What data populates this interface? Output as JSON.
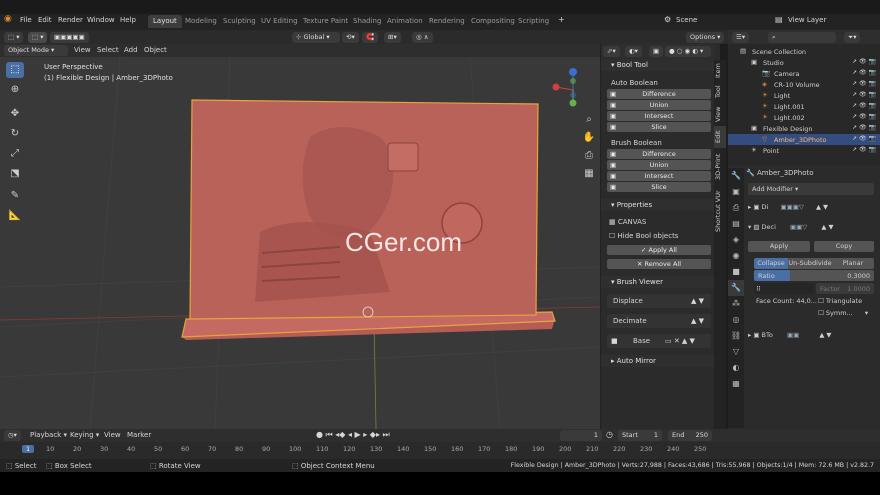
{
  "menu": {
    "file": "File",
    "edit": "Edit",
    "render": "Render",
    "window": "Window",
    "help": "Help"
  },
  "workspaces": [
    "Layout",
    "Modeling",
    "Sculpting",
    "UV Editing",
    "Texture Paint",
    "Shading",
    "Animation",
    "Rendering",
    "Compositing",
    "Scripting"
  ],
  "scene": {
    "label": "Scene",
    "view_layer": "View Layer"
  },
  "header": {
    "mode": "Object Mode",
    "view": "View",
    "select": "Select",
    "add": "Add",
    "object": "Object",
    "orientation": "Global",
    "options": "Options"
  },
  "viewport": {
    "perspective": "User Perspective",
    "context": "(1) Flexible Design | Amber_3DPhoto",
    "watermark": "CGer.com"
  },
  "bool_tool": {
    "title": "Bool Tool",
    "auto_boolean": "Auto Boolean",
    "auto_ops": [
      "Difference",
      "Union",
      "Intersect",
      "Slice"
    ],
    "brush_boolean": "Brush Boolean",
    "brush_ops": [
      "Difference",
      "Union",
      "Intersect",
      "Slice"
    ],
    "properties": "Properties",
    "canvas": "CANVAS",
    "hide_bool": "Hide Bool objects",
    "apply_all": "Apply All",
    "remove_all": "Remove All",
    "brush_viewer": "Brush Viewer",
    "viewer_items": [
      "Displace",
      "Decimate",
      "Base"
    ],
    "auto_mirror": "Auto Mirror"
  },
  "vtabs": [
    "Item",
    "Tool",
    "View",
    "Edit",
    "3D-Print",
    "Shortcut VUr"
  ],
  "outliner": {
    "search_placeholder": "",
    "rows": [
      {
        "label": "Scene Collection",
        "indent": 0,
        "sel": false
      },
      {
        "label": "Studio",
        "indent": 1,
        "sel": false
      },
      {
        "label": "Camera",
        "indent": 2,
        "sel": false
      },
      {
        "label": "CR-10 Volume",
        "indent": 2,
        "sel": false
      },
      {
        "label": "Light",
        "indent": 2,
        "sel": false
      },
      {
        "label": "Light.001",
        "indent": 2,
        "sel": false
      },
      {
        "label": "Light.002",
        "indent": 2,
        "sel": false
      },
      {
        "label": "Flexible Design",
        "indent": 1,
        "sel": false
      },
      {
        "label": "Amber_3DPhoto",
        "indent": 2,
        "sel": true
      },
      {
        "label": "Point",
        "indent": 1,
        "sel": false
      }
    ]
  },
  "properties": {
    "object": "Amber_3DPhoto",
    "add_modifier": "Add Modifier",
    "mod1": "Di",
    "mod2": "Deci",
    "apply": "Apply",
    "copy": "Copy",
    "collapse": "Collapse",
    "unsubdivide": "Un-Subdivide",
    "planar": "Planar",
    "ratio_label": "Ratio",
    "ratio_value": "0.3000",
    "factor_label": "Factor",
    "factor_value": "1.0000",
    "face_count": "Face Count: 44,0...",
    "triangulate": "Triangulate",
    "symmetry": "Symm...",
    "mod3": "BTo"
  },
  "timeline": {
    "playback": "Playback",
    "keying": "Keying",
    "view": "View",
    "marker": "Marker",
    "current_frame": "1",
    "start_label": "Start",
    "start": "1",
    "end_label": "End",
    "end": "250",
    "ticks": [
      "1",
      "10",
      "20",
      "30",
      "40",
      "50",
      "60",
      "70",
      "80",
      "90",
      "100",
      "110",
      "120",
      "130",
      "140",
      "150",
      "160",
      "170",
      "180",
      "190",
      "200",
      "210",
      "220",
      "230",
      "240",
      "250"
    ]
  },
  "status": {
    "select": "Select",
    "box_select": "Box Select",
    "rotate_view": "Rotate View",
    "context_menu": "Object Context Menu",
    "stats": "Flexible Design | Amber_3DPhoto | Verts:27,988 | Faces:43,686 | Tris:55,968 | Objects:1/4 | Mem: 72.6 MB | v2.82.7"
  },
  "colors": {
    "accent": "#4a6fa5",
    "selection": "#e8a33a",
    "model": "#b8605a",
    "watermark": "#ffffff"
  }
}
